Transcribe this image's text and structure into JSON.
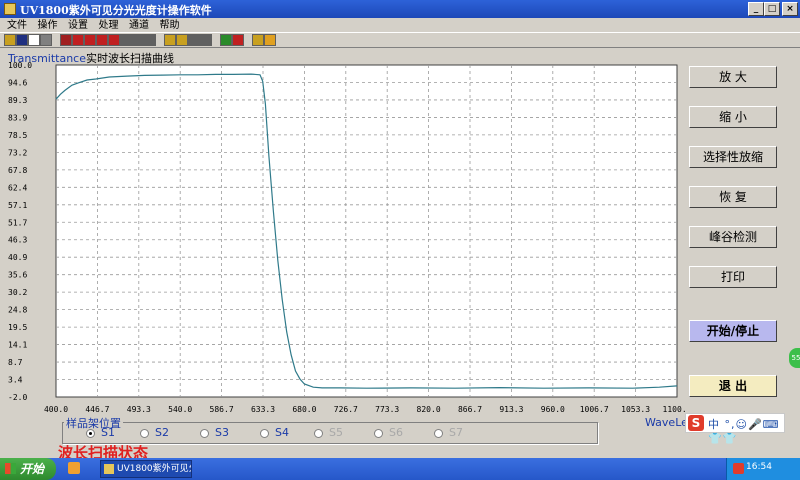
{
  "window": {
    "title": "UV1800紫外可见分光光度计操作软件",
    "controls": [
      "_",
      "□",
      "×"
    ]
  },
  "menu": [
    "文件",
    "操作",
    "设置",
    "处理",
    "通道",
    "帮助"
  ],
  "toolbar": {
    "icons": [
      {
        "name": "open-icon",
        "color": "#c8a020"
      },
      {
        "name": "save-icon",
        "color": "#203080"
      },
      {
        "name": "new-icon",
        "color": "#ffffff"
      },
      {
        "name": "print-icon",
        "color": "#808080"
      },
      {
        "name": "photometric-icon",
        "color": "#a02020"
      },
      {
        "name": "quant-icon",
        "color": "#c02020"
      },
      {
        "name": "kinetics-icon",
        "color": "#c02020"
      },
      {
        "name": "dna-icon",
        "color": "#c02020"
      },
      {
        "name": "scan-icon",
        "color": "#c02020"
      },
      {
        "name": "tool-icon",
        "color": "#606060"
      },
      {
        "name": "wrench-icon",
        "color": "#606060"
      },
      {
        "name": "settings-icon",
        "color": "#606060"
      },
      {
        "name": "baseline-icon",
        "color": "#c8a020"
      },
      {
        "name": "cross-icon",
        "color": "#c8a020"
      },
      {
        "name": "zero-icon",
        "color": "#606060"
      },
      {
        "name": "reset-icon",
        "color": "#606060"
      },
      {
        "name": "chart-icon",
        "color": "#2a8a2a"
      },
      {
        "name": "pen-icon",
        "color": "#c02020"
      },
      {
        "name": "help-icon",
        "color": "#c8a020"
      },
      {
        "name": "warning-icon",
        "color": "#e0a020"
      }
    ]
  },
  "chart_title": {
    "english": "Transmittance",
    "chinese": "实时波长扫描曲线"
  },
  "chart_data": {
    "type": "line",
    "ylim": [
      -2.0,
      100.0
    ],
    "xlim": [
      400.0,
      1100.0
    ],
    "y_ticks": [
      "100.0",
      "94.6",
      "89.3",
      "83.9",
      "78.5",
      "73.2",
      "67.8",
      "62.4",
      "57.1",
      "51.7",
      "46.3",
      "40.9",
      "35.6",
      "30.2",
      "24.8",
      "19.5",
      "14.1",
      "8.7",
      "3.4",
      "-2.0"
    ],
    "x_ticks": [
      "400.0",
      "446.7",
      "493.3",
      "540.0",
      "586.7",
      "633.3",
      "680.0",
      "726.7",
      "773.3",
      "820.0",
      "866.7",
      "913.3",
      "960.0",
      "1006.7",
      "1053.3",
      "1100.0"
    ],
    "grid": true,
    "series": [
      {
        "color": "#2f7a8a",
        "x": [
          400,
          405,
          410,
          418,
          425,
          435,
          445,
          460,
          480,
          500,
          520,
          540,
          560,
          580,
          600,
          620,
          630,
          633,
          636,
          640,
          645,
          650,
          655,
          660,
          665,
          670,
          675,
          680,
          690,
          700,
          720,
          750,
          800,
          850,
          900,
          950,
          1000,
          1050,
          1080,
          1100
        ],
        "y": [
          89.5,
          91.0,
          92.2,
          93.8,
          94.5,
          95.4,
          95.7,
          96.3,
          96.6,
          96.8,
          96.9,
          97.0,
          97.0,
          97.1,
          97.1,
          97.2,
          97.0,
          95.0,
          88.0,
          72.0,
          55.0,
          40.0,
          28.0,
          18.0,
          11.0,
          6.0,
          3.5,
          2.0,
          1.0,
          0.8,
          0.8,
          0.7,
          0.8,
          0.7,
          0.9,
          0.7,
          0.8,
          0.7,
          1.0,
          1.4
        ]
      }
    ]
  },
  "sidebar": {
    "zoom_in": "放 大",
    "zoom_out": "缩 小",
    "selective_zoom": "选择性放缩",
    "restore": "恢 复",
    "peak_detect": "峰谷检测",
    "print": "打印",
    "start_stop": "开始/停止",
    "exit": "退 出"
  },
  "sample_holder": {
    "label": "样品架位置",
    "options": [
      {
        "label": "S1",
        "selected": true,
        "enabled": true
      },
      {
        "label": "S2",
        "selected": false,
        "enabled": true
      },
      {
        "label": "S3",
        "selected": false,
        "enabled": true
      },
      {
        "label": "S4",
        "selected": false,
        "enabled": true
      },
      {
        "label": "S5",
        "selected": false,
        "enabled": false
      },
      {
        "label": "S6",
        "selected": false,
        "enabled": false
      },
      {
        "label": "S7",
        "selected": false,
        "enabled": false
      }
    ]
  },
  "wavelength_label": "WaveLen",
  "status": "波长扫描状态",
  "ime": {
    "logo": "S",
    "text": "中 °,☺🎤⌨👕👕"
  },
  "taskbar": {
    "start": "开始",
    "task": "UV1800紫外可见分...",
    "clock": "16:54"
  },
  "colors": {
    "titlebar": "#2456c9",
    "face": "#d4d0c8",
    "plot_bg": "#ffffff",
    "grid": "#9a9a9a",
    "curve": "#2f7a8a",
    "status_text": "#e02020"
  }
}
